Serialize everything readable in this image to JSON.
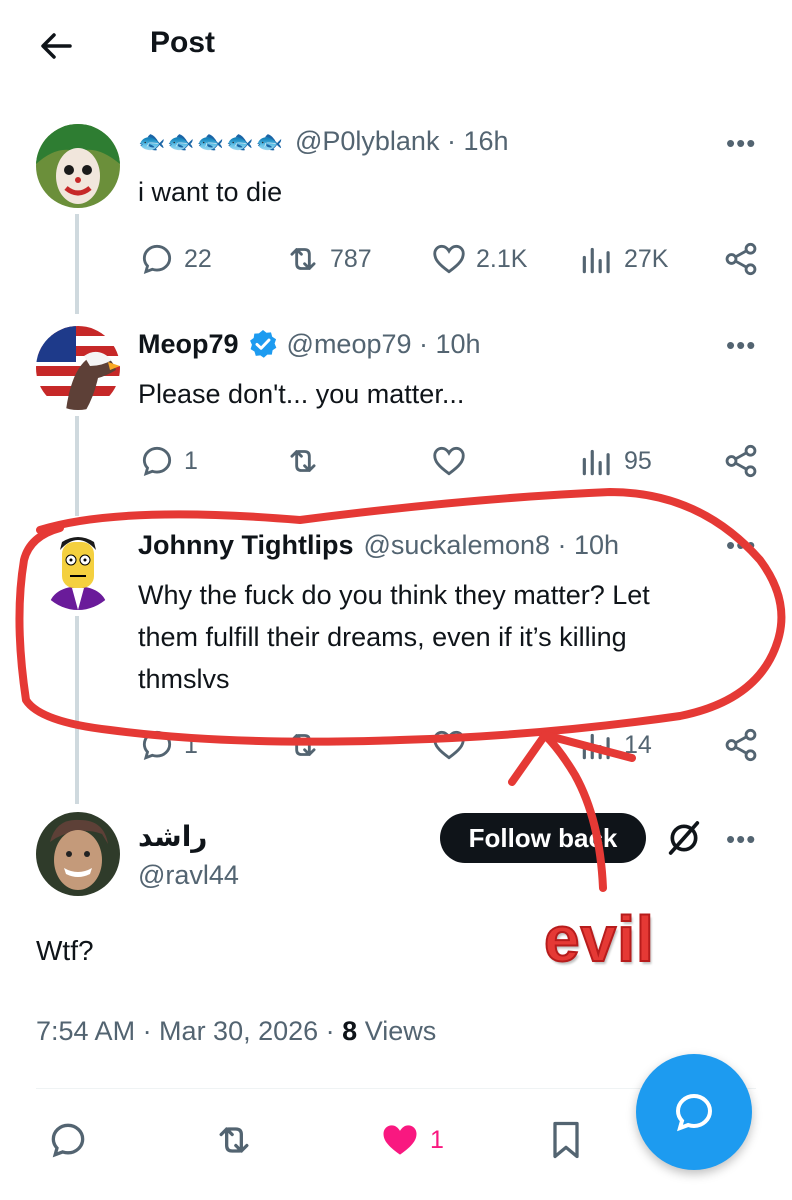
{
  "header": {
    "title": "Post"
  },
  "tweets": [
    {
      "display_name": "🐟🐟🐟🐟🐟",
      "handle_time": "@P0lyblank · 16h",
      "text": "i want to die",
      "replies": "22",
      "retweets": "787",
      "likes": "2.1K",
      "views": "27K"
    },
    {
      "display_name": "Meop79",
      "handle_time": "@meop79 · 10h",
      "text": "Please don't... you matter...",
      "replies": "1",
      "views": "95"
    },
    {
      "display_name": "Johnny Tightlips",
      "handle_time": "@suckalemon8 · 10h",
      "text_lines": [
        "Why the fuck do you think they matter? Let",
        "them fulfill their dreams, even if it’s killing",
        "thmslvs"
      ],
      "replies": "1",
      "views": "14"
    }
  ],
  "main_post": {
    "display_name": "راشد",
    "handle": "@ravl44",
    "follow_label": "Follow back",
    "text": "Wtf?",
    "time": "7:54 AM · Mar 30, 2026 · ",
    "views_count": "8",
    "views_label": " Views",
    "likes": "1"
  },
  "annotation": {
    "text": "evil",
    "color": "#e53935"
  },
  "colors": {
    "accent": "#1d9bf0",
    "like_pink": "#f91880",
    "verified": "#1d9bf0"
  }
}
